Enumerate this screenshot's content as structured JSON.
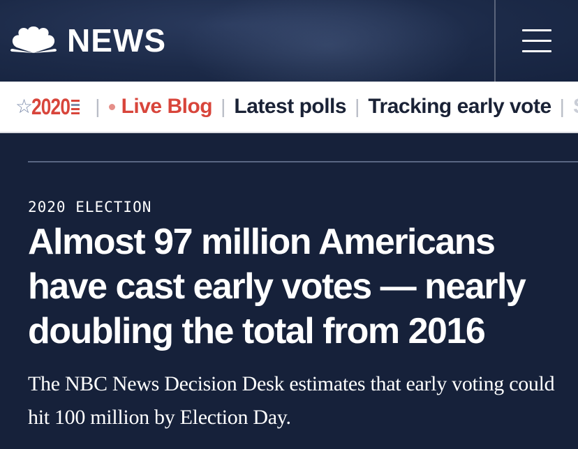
{
  "header": {
    "logo_text": "NEWS",
    "logo_icon": "nbc-peacock-icon",
    "menu_icon": "hamburger-menu-icon"
  },
  "subnav": {
    "badge_year": "2020",
    "items": [
      {
        "label": "Live Blog",
        "style": "live"
      },
      {
        "label": "Latest polls",
        "style": "normal"
      },
      {
        "label": "Tracking early vote",
        "style": "normal"
      },
      {
        "label": "St",
        "style": "faded"
      }
    ]
  },
  "article": {
    "eyebrow": "2020 ELECTION",
    "headline": "Almost 97 million Americans have cast early votes — nearly doubling the total from 2016",
    "dek": "The NBC News Decision Desk estimates that early voting could hit 100 million by Election Day."
  },
  "colors": {
    "header_bg": "#1c2a48",
    "page_bg": "#16213a",
    "accent_red": "#d8453b",
    "nav_text": "#1a2236"
  }
}
